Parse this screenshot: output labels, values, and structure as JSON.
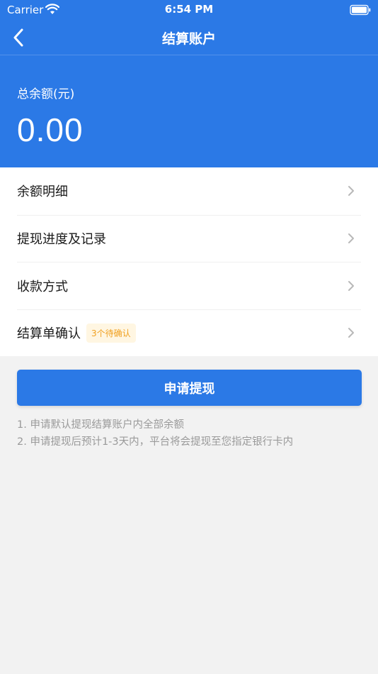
{
  "colors": {
    "primary": "#2b79e6",
    "badge_text": "#f0a020",
    "badge_bg": "#fff6e2",
    "page_bg": "#f2f2f2"
  },
  "status_bar": {
    "carrier": "Carrier",
    "time": "6:54 PM",
    "wifi_icon": "wifi-icon",
    "battery_icon": "battery-icon"
  },
  "nav": {
    "back_icon": "chevron-left-icon",
    "title": "结算账户"
  },
  "balance": {
    "label": "总余额(元)",
    "value": "0.00"
  },
  "menu": {
    "items": [
      {
        "label": "余额明细",
        "icon": "chevron-right-icon"
      },
      {
        "label": "提现进度及记录",
        "icon": "chevron-right-icon"
      },
      {
        "label": "收款方式",
        "icon": "chevron-right-icon"
      },
      {
        "label": "结算单确认",
        "badge": "3个待确认",
        "icon": "chevron-right-icon"
      }
    ]
  },
  "apply_button": {
    "label": "申请提现"
  },
  "notes": [
    "1. 申请默认提现结算账户内全部余额",
    "2. 申请提现后预计1-3天内，平台将会提现至您指定银行卡内"
  ]
}
